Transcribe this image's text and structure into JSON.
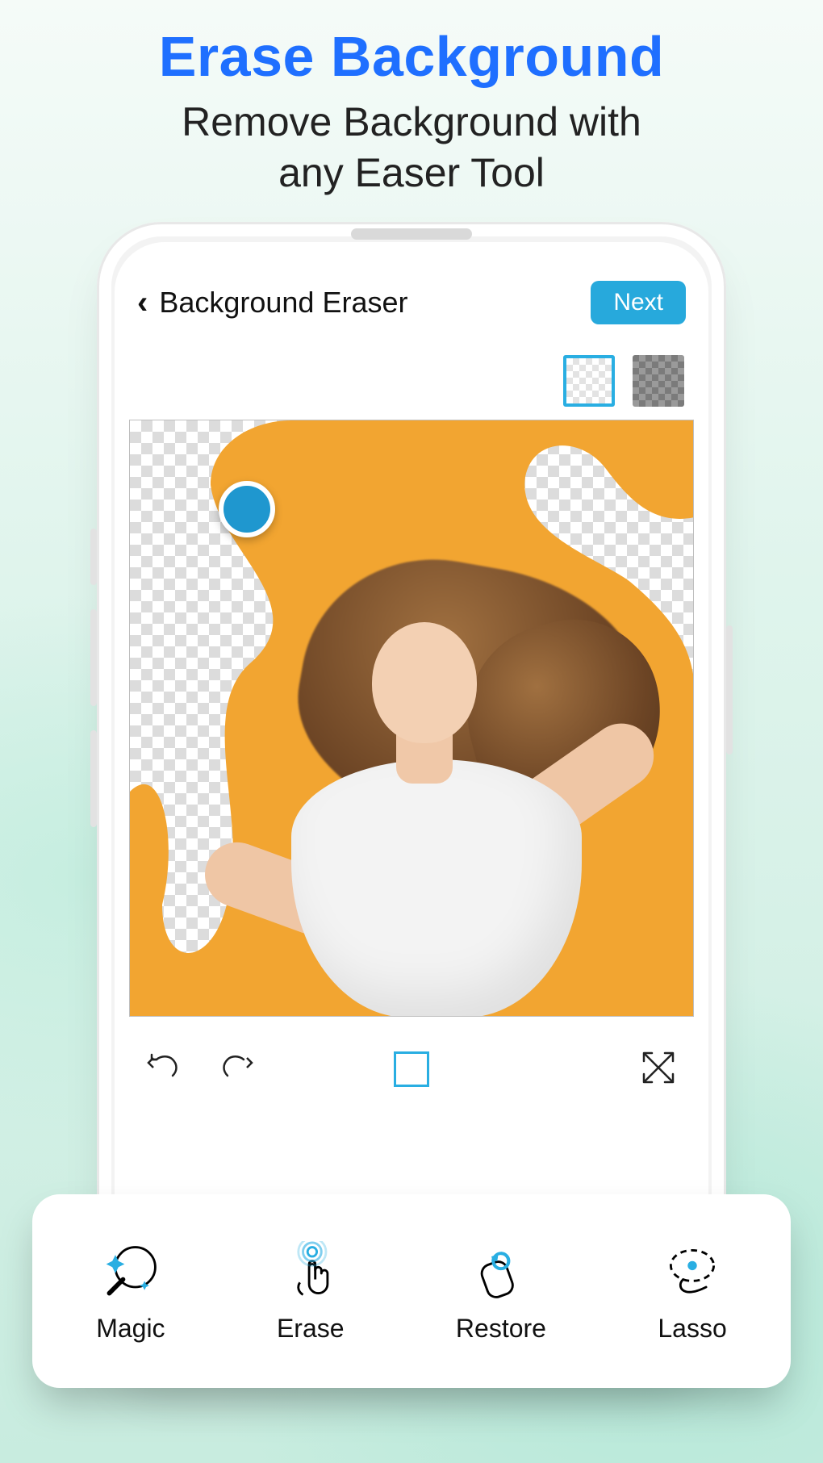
{
  "promo": {
    "title": "Erase Background",
    "subtitle_line1": "Remove Background with",
    "subtitle_line2": "any Easer Tool"
  },
  "app": {
    "screen_title": "Background Eraser",
    "next_label": "Next",
    "colors": {
      "accent": "#29aee2",
      "promo_title": "#1f6fff",
      "canvas_bg": "#f2a531"
    }
  },
  "preview_modes": {
    "light_selected": true
  },
  "secondary_bar": {
    "undo": "undo-icon",
    "redo": "redo-icon",
    "crop": "crop-icon",
    "expand": "expand-icon"
  },
  "tools": [
    {
      "id": "magic",
      "label": "Magic",
      "icon": "magic-wand-icon"
    },
    {
      "id": "erase",
      "label": "Erase",
      "icon": "touch-erase-icon"
    },
    {
      "id": "restore",
      "label": "Restore",
      "icon": "restore-icon"
    },
    {
      "id": "lasso",
      "label": "Lasso",
      "icon": "lasso-icon"
    }
  ]
}
